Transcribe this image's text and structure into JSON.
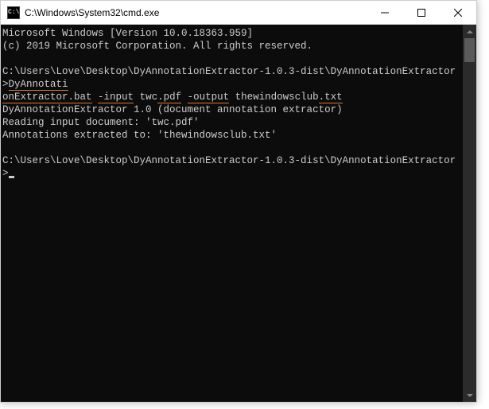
{
  "titlebar": {
    "icon_label": "cmd-icon",
    "title": "C:\\Windows\\System32\\cmd.exe"
  },
  "console": {
    "header_line1": "Microsoft Windows [Version 10.0.18363.959]",
    "header_line2": "(c) 2019 Microsoft Corporation. All rights reserved.",
    "prompt1": "C:\\Users\\Love\\Desktop\\DyAnnotationExtractor-1.0.3-dist\\DyAnnotationExtractor>",
    "cmd1_part1": "DyAnnotati",
    "cmd1_part2": "onExtractor.bat",
    "cmd1_space1": " ",
    "cmd1_part3": "-input",
    "cmd1_space2": " twc",
    "cmd1_part4": ".pdf",
    "cmd1_space3": " ",
    "cmd1_part5": "-output",
    "cmd1_space4": " thewindowsclub",
    "cmd1_part6": ".txt",
    "output_line1": "DyAnnotationExtractor 1.0 (document annotation extractor)",
    "output_line2": "Reading input document: 'twc.pdf'",
    "output_line3": "Annotations extracted to: 'thewindowsclub.txt'",
    "prompt2": "C:\\Users\\Love\\Desktop\\DyAnnotationExtractor-1.0.3-dist\\DyAnnotationExtractor>"
  },
  "colors": {
    "console_bg": "#0c0c0c",
    "console_fg": "#cccccc",
    "underline": "#d97830"
  }
}
